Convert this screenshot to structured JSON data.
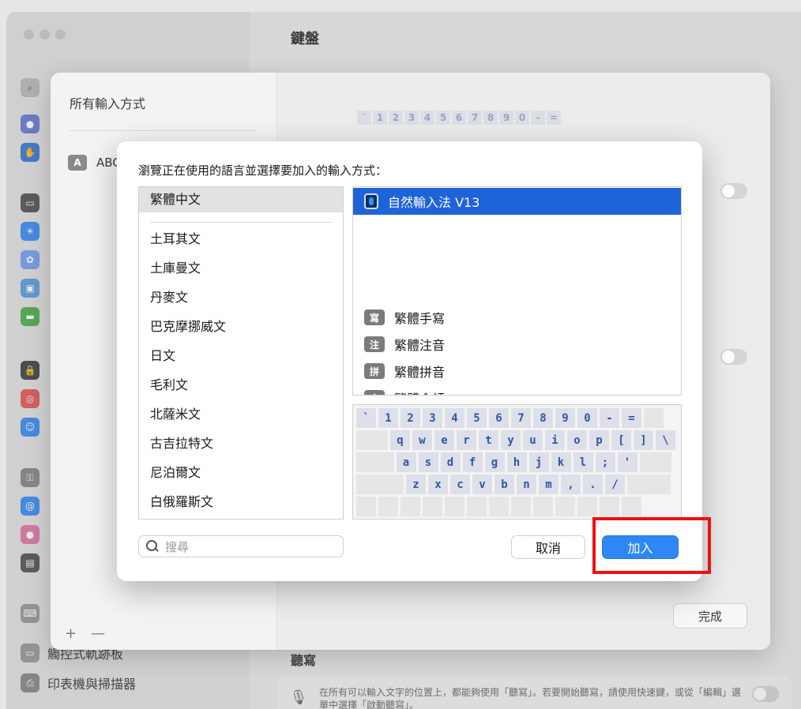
{
  "window": {
    "title": "鍵盤",
    "bottom_items": [
      {
        "label": "觸控式軌跡板",
        "icon": "trackpad-icon"
      },
      {
        "label": "印表機與掃描器",
        "icon": "printer-icon"
      }
    ],
    "dictation": {
      "section_title": "聽寫",
      "description": "在所有可以輸入文字的位置上，都能夠使用「聽寫」。若要開始聽寫，請使用快速鍵，或從「編輯」選單中選擇「啟動聽寫」。"
    }
  },
  "sheet": {
    "title": "所有輸入方式",
    "item": {
      "badge": "A",
      "label": "ABC"
    },
    "done_label": "完成",
    "add_symbol": "+",
    "remove_symbol": "—",
    "mini_keys": [
      "`",
      "1",
      "2",
      "3",
      "4",
      "5",
      "6",
      "7",
      "8",
      "9",
      "0",
      "-",
      "="
    ]
  },
  "dialog": {
    "title": "瀏覽正在使用的語言並選擇要加入的輸入方式：",
    "languages": [
      "繁體中文",
      "土耳其文",
      "土庫曼文",
      "丹麥文",
      "巴克摩挪威文",
      "日文",
      "毛利文",
      "北薩米文",
      "古吉拉特文",
      "尼泊爾文",
      "白俄羅斯文"
    ],
    "selected_language": "繁體中文",
    "input_methods": [
      {
        "badge": "",
        "label": "自然輸入法 V13",
        "selected": true,
        "icon": "natural-ime-icon"
      },
      {
        "badge": "寫",
        "label": "繁體手寫",
        "selected": false
      },
      {
        "badge": "注",
        "label": "繁體注音",
        "selected": false
      },
      {
        "badge": "拼",
        "label": "繁體拼音",
        "selected": false
      },
      {
        "badge": "倉",
        "label": "繁體倉頡",
        "selected": false
      }
    ],
    "keyboard": {
      "row1": [
        "`",
        "1",
        "2",
        "3",
        "4",
        "5",
        "6",
        "7",
        "8",
        "9",
        "0",
        "-",
        "="
      ],
      "row2": [
        "q",
        "w",
        "e",
        "r",
        "t",
        "y",
        "u",
        "i",
        "o",
        "p",
        "[",
        "]",
        "\\"
      ],
      "row3": [
        "a",
        "s",
        "d",
        "f",
        "g",
        "h",
        "j",
        "k",
        "l",
        ";",
        "'"
      ],
      "row4": [
        "z",
        "x",
        "c",
        "v",
        "b",
        "n",
        "m",
        ",",
        ".",
        "/"
      ]
    },
    "search_placeholder": "搜尋",
    "cancel_label": "取消",
    "add_label": "加入"
  },
  "colors": {
    "accent": "#2f87f5",
    "selection": "#1f63d9",
    "highlight_box": "#ee1111"
  }
}
